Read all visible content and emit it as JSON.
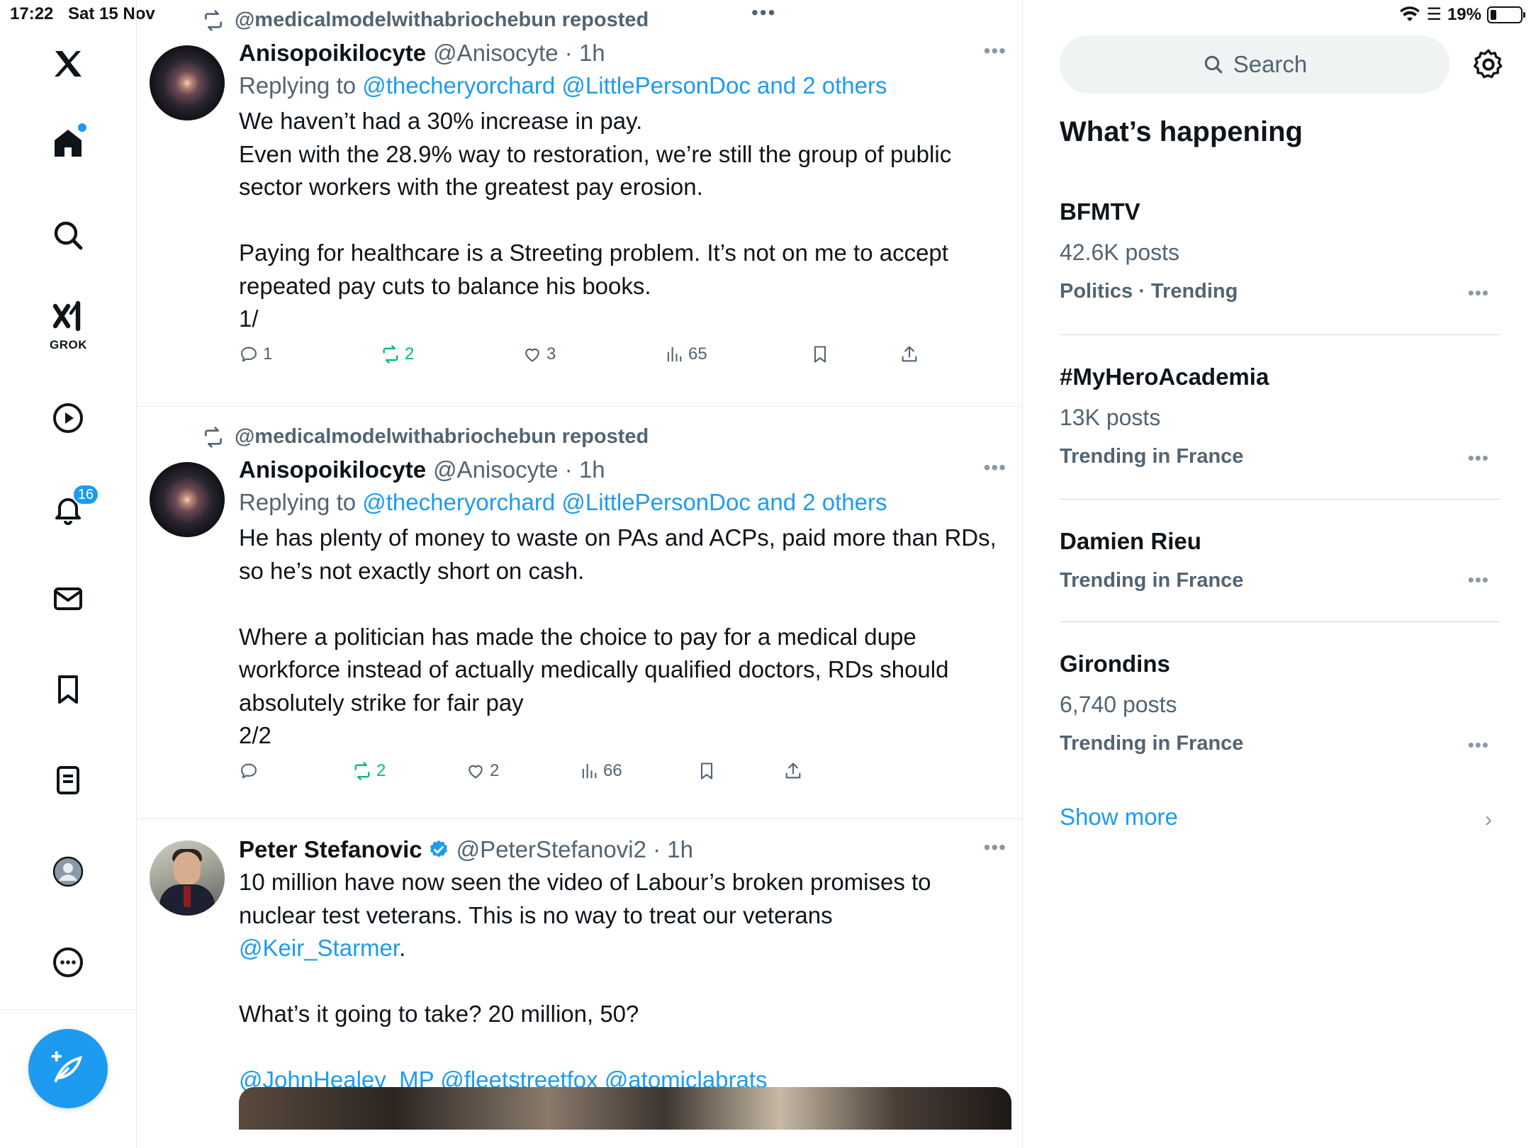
{
  "status": {
    "time": "17:22",
    "date": "Sat 15 Nov",
    "battery": "19%"
  },
  "nav": {
    "grok_label": "GROK",
    "notifications_badge": "16",
    "items": [
      "x-logo",
      "home",
      "search",
      "grok",
      "video",
      "notifications",
      "messages",
      "bookmarks",
      "lists",
      "profile",
      "more"
    ]
  },
  "colors": {
    "accent": "#1d9bf0",
    "repost_green": "#00ba7c",
    "muted": "#536471"
  },
  "posts": [
    {
      "repost_by": "@medicalmodelwithabriochebun reposted",
      "name": "Anisopoikilocyte",
      "handle": "@Anisocyte · 1h",
      "reply_prefix": "Replying to ",
      "reply_to": "@thecheryorchard @LittlePersonDoc and 2 others",
      "text": "We haven’t had a 30% increase in pay.\nEven with the 28.9% way to restoration, we’re still the group of public sector workers with the greatest pay erosion.\n\nPaying for healthcare is a Streeting problem. It’s not on me to accept repeated pay cuts to balance his books.\n1/",
      "replies": "1",
      "reposts": "2",
      "likes": "3",
      "views": "65"
    },
    {
      "repost_by": "@medicalmodelwithabriochebun reposted",
      "name": "Anisopoikilocyte",
      "handle": "@Anisocyte · 1h",
      "reply_prefix": "Replying to ",
      "reply_to": "@thecheryorchard @LittlePersonDoc and 2 others",
      "text": "He has plenty of money to waste on PAs and ACPs, paid more than RDs, so he’s not exactly short on cash.\n\nWhere a politician has made the choice to pay for a medical dupe workforce instead of actually medically qualified doctors, RDs should absolutely strike for fair pay\n2/2",
      "replies": "",
      "reposts": "2",
      "likes": "2",
      "views": "66"
    },
    {
      "name": "Peter Stefanovic",
      "handle": "@PeterStefanovi2 · 1h",
      "text_line1": "10 million have now seen the video of Labour’s broken promises to nuclear test veterans. This is no way to treat our veterans",
      "mention": "@Keir_Starmer",
      "text_after_mention": ".",
      "text_para2": "What’s it going to take? 20 million, 50?",
      "mentions_line": "@JohnHealey_MP @fleetstreetfox @atomiclabrats"
    }
  ],
  "right": {
    "search_placeholder": "Search",
    "whats_happening": "What’s happening",
    "trends": [
      {
        "title": "BFMTV",
        "posts": "42.6K posts",
        "meta": "Politics · Trending"
      },
      {
        "title": "#MyHeroAcademia",
        "posts": "13K posts",
        "meta": "Trending in France"
      },
      {
        "title": "Damien Rieu",
        "posts": "",
        "meta": "Trending in France"
      },
      {
        "title": "Girondins",
        "posts": "6,740 posts",
        "meta": "Trending in France"
      }
    ],
    "show_more": "Show more"
  }
}
